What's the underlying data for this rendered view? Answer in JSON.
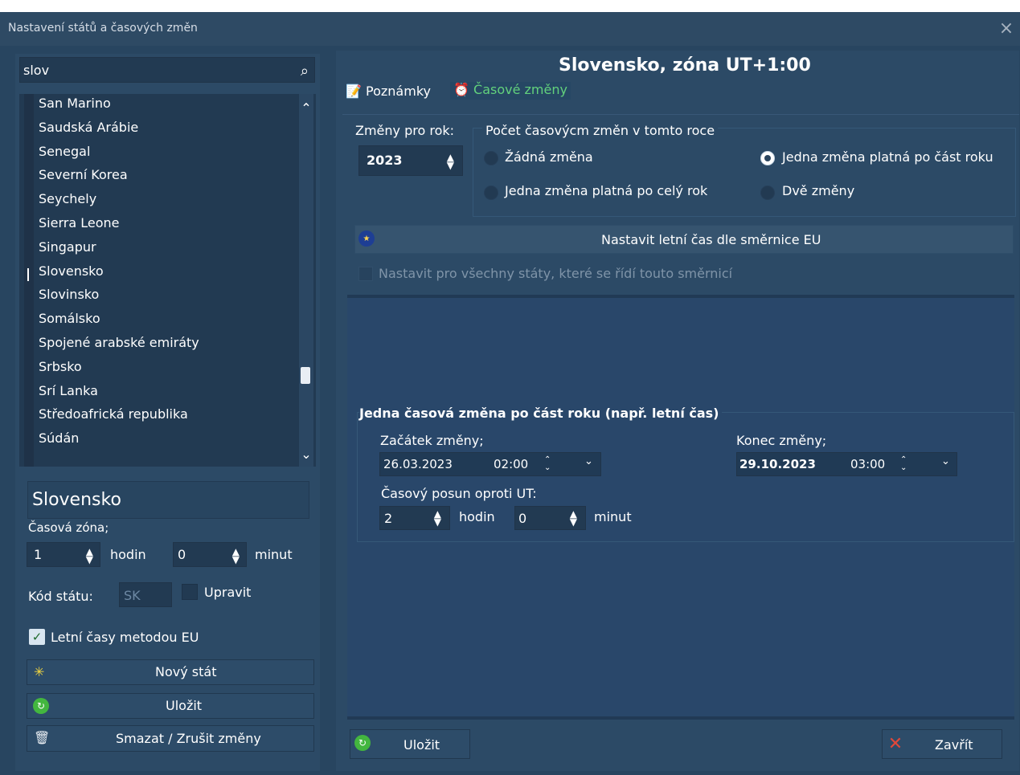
{
  "window": {
    "title": "Nastavení států a časových změn"
  },
  "search": {
    "value": "slov"
  },
  "countries": [
    "San Marino",
    "Saudská Arábie",
    "Senegal",
    "Severní Korea",
    "Seychely",
    "Sierra Leone",
    "Singapur",
    "Slovensko",
    "Slovinsko",
    "Somálsko",
    "Spojené arabské emiráty",
    "Srbsko",
    "Srí Lanka",
    "Středoafrická republika",
    "Súdán"
  ],
  "left": {
    "country_name": "Slovensko",
    "timezone_label": "Časová zóna;",
    "hours_value": "1",
    "hours_unit": "hodin",
    "minutes_value": "0",
    "minutes_unit": "minut",
    "code_label": "Kód státu:",
    "code_value": "SK",
    "edit_label": "Upravit",
    "eu_label": "Letní časy metodou EU",
    "new_button": "Nový stát",
    "save_button": "Uložit",
    "delete_button": "Smazat / Zrušit změny"
  },
  "right": {
    "header": "Slovensko, zóna UT+1:00",
    "tabs": {
      "notes": "Poznámky",
      "changes": "Časové změny"
    },
    "year_label": "Změny pro rok:",
    "year_value": "2023",
    "group_label": "Počet časovýcm změn v tomto roce",
    "radios": {
      "none": "Žádná změna",
      "one_year": "Jedna změna platná po celý rok",
      "one_part": "Jedna změna platná po část roku",
      "two": "Dvě změny"
    },
    "eu_button": "Nastavit letní čas dle směrnice EU",
    "apply_all": "Nastavit pro všechny státy, které se řídí touto  směrnicí",
    "part_group": "Jedna časová změna po část roku (např. letní čas)",
    "start_label": "Začátek změny;",
    "start_date": "26.03.2023",
    "start_time": "02:00",
    "end_label": "Konec změny;",
    "end_date": "29.10.2023",
    "end_time": "03:00",
    "offset_label": "Časový posun oproti UT:",
    "offset_hours": "2",
    "offset_hours_unit": "hodin",
    "offset_minutes": "0",
    "offset_minutes_unit": "minut",
    "save_button": "Uložit",
    "close_button": "Zavřít"
  }
}
